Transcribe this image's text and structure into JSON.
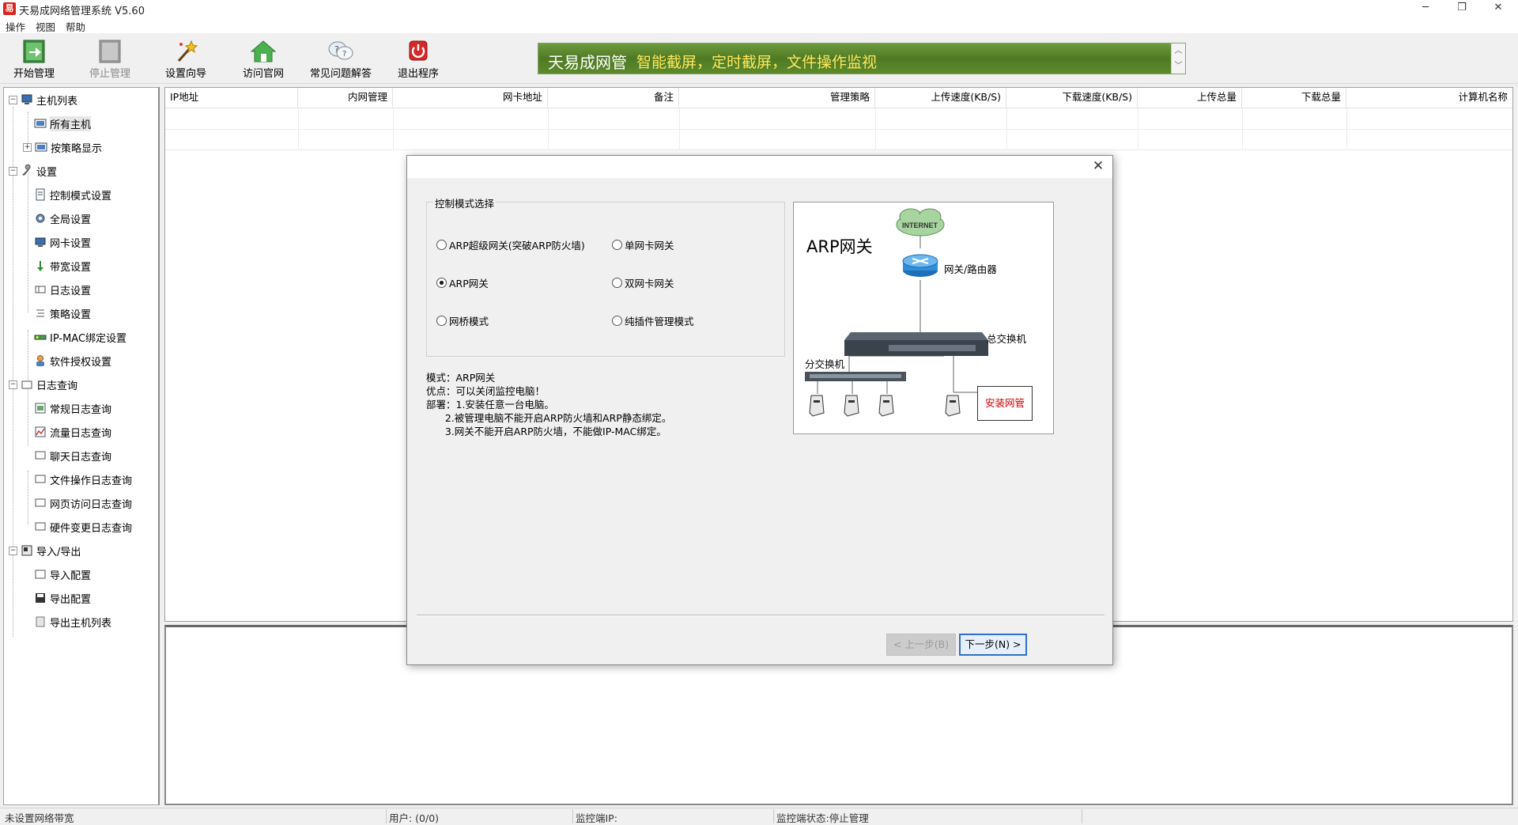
{
  "window": {
    "title": "天易成网络管理系统 V5.60",
    "app_icon_glyph": "易",
    "minimize": "─",
    "restore": "❐",
    "close": "✕"
  },
  "menu": [
    "操作",
    "视图",
    "帮助"
  ],
  "toolbar": {
    "buttons": [
      {
        "label": "开始管理",
        "enabled": true
      },
      {
        "label": "停止管理",
        "enabled": false
      },
      {
        "label": "设置向导",
        "enabled": true
      },
      {
        "label": "访问官网",
        "enabled": true
      },
      {
        "label": "常见问题解答",
        "enabled": true
      },
      {
        "label": "退出程序",
        "enabled": true
      }
    ],
    "banner_brand": "天易成网管",
    "banner_slogan": "智能截屏，定时截屏，文件操作监视"
  },
  "tree": {
    "host_list": "主机列表",
    "all_hosts": "所有主机",
    "by_policy": "按策略显示",
    "settings": "设置",
    "control_mode": "控制模式设置",
    "global": "全局设置",
    "nic": "网卡设置",
    "bandwidth": "带宽设置",
    "log_settings": "日志设置",
    "policy": "策略设置",
    "ip_mac": "IP-MAC绑定设置",
    "license": "软件授权设置",
    "log_query": "日志查询",
    "general_log": "常规日志查询",
    "traffic_log": "流量日志查询",
    "chat_log": "聊天日志查询",
    "file_log": "文件操作日志查询",
    "web_log": "网页访问日志查询",
    "hardware_log": "硬件变更日志查询",
    "import_export": "导入/导出",
    "import_config": "导入配置",
    "export_config": "导出配置",
    "export_hosts": "导出主机列表"
  },
  "table": {
    "columns": [
      "IP地址",
      "内网管理",
      "网卡地址",
      "备注",
      "管理策略",
      "上传速度(KB/S)",
      "下载速度(KB/S)",
      "上传总量",
      "下载总量",
      "计算机名称"
    ]
  },
  "status": {
    "bandwidth": "未设置网络带宽",
    "users": "用户: (0/0)",
    "monitor_ip": "监控端IP:",
    "monitor_state": "监控端状态:停止管理"
  },
  "dialog": {
    "close": "✕",
    "group_title": "控制模式选择",
    "modes": [
      {
        "label": "ARP超级网关(突破ARP防火墙)",
        "selected": false
      },
      {
        "label": "单网卡网关",
        "selected": false
      },
      {
        "label": "ARP网关",
        "selected": true
      },
      {
        "label": "双网卡网关",
        "selected": false
      },
      {
        "label": "网桥模式",
        "selected": false
      },
      {
        "label": "纯插件管理模式",
        "selected": false
      }
    ],
    "description": [
      "模式：ARP网关",
      "优点：可以关闭监控电脑！",
      "部署：1.安装任意一台电脑。",
      "      2.被管理电脑不能开启ARP防火墙和ARP静态绑定。",
      "      3.网关不能开启ARP防火墙，不能做IP-MAC绑定。"
    ],
    "diagram": {
      "title": "ARP网关",
      "internet": "INTERNET",
      "router": "网关/路由器",
      "core_switch": "总交换机",
      "branch_switch": "分交换机",
      "install": "安装网管"
    },
    "prev": "< 上一步(B)",
    "next": "下一步(N) >"
  }
}
